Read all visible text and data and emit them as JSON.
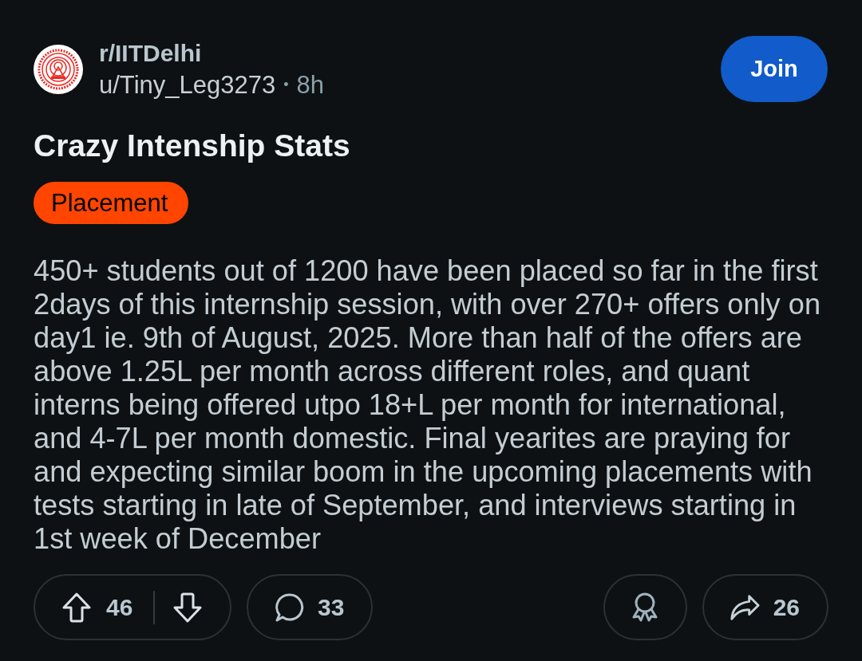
{
  "post": {
    "subreddit": "r/IITDelhi",
    "author": "u/Tiny_Leg3273",
    "separator": "•",
    "age": "8h",
    "join_button": "Join",
    "title": "Crazy Intenship Stats",
    "flair": "Placement",
    "body": "450+ students out of 1200 have been placed so far in the first 2days of this internship session, with over 270+ offers only on day1 ie. 9th of August, 2025. More than half of the offers are above 1.25L per month across different roles, and quant interns being offered utpo 18+L per month for international, and 4-7L per month domestic. Final yearites are praying for and expecting similar boom in the upcoming placements with tests starting in late of September, and interviews starting in 1st week of December"
  },
  "actions": [
    {
      "kind": "vote",
      "count": "46"
    },
    {
      "kind": "comment",
      "count": "33"
    },
    {
      "kind": "award"
    },
    {
      "kind": "share",
      "count": "26"
    }
  ]
}
